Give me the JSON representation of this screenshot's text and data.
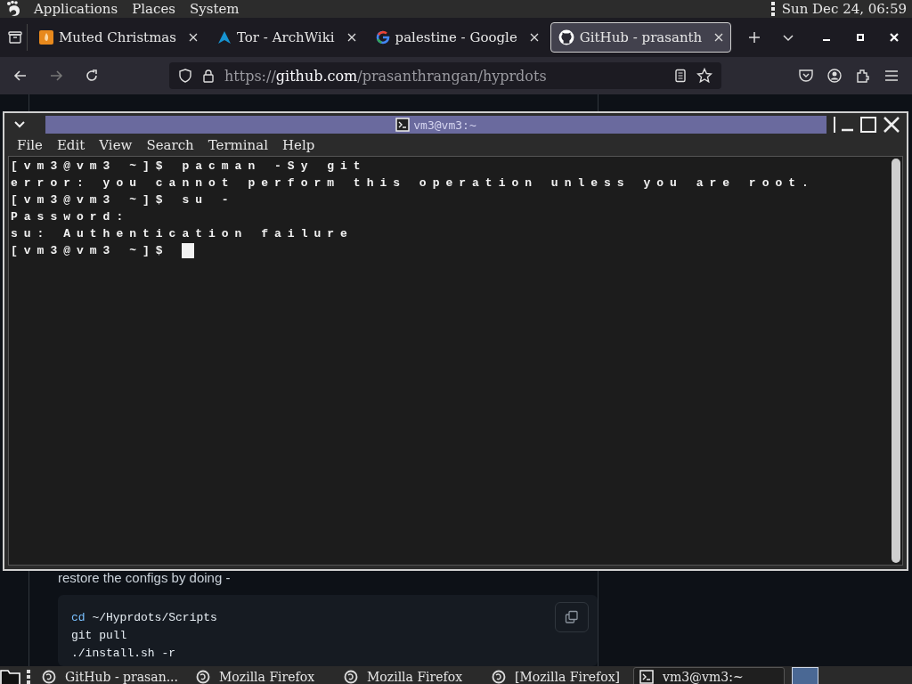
{
  "top_panel": {
    "menus": [
      "Applications",
      "Places",
      "System"
    ],
    "clock": "Sun Dec 24, 06:59"
  },
  "browser": {
    "tabs": [
      {
        "label": "Muted Christmas",
        "kind": "music",
        "selected": false
      },
      {
        "label": "Tor - ArchWiki",
        "kind": "arch",
        "selected": false
      },
      {
        "label": "palestine - Google",
        "kind": "google",
        "selected": false
      },
      {
        "label": "GitHub - prasanth",
        "kind": "github",
        "selected": true
      }
    ],
    "url": {
      "scheme": "https://",
      "host": "github.com",
      "path": "/prasanthrangan/hyprdots"
    }
  },
  "page": {
    "text": "restore the configs by doing -",
    "code": [
      {
        "keyword": "cd",
        "text": " ~/Hyprdots/Scripts"
      },
      {
        "text": "git pull"
      },
      {
        "text": "./install.sh -r"
      }
    ]
  },
  "terminal": {
    "title": "vm3@vm3:~",
    "menus": [
      "File",
      "Edit",
      "View",
      "Search",
      "Terminal",
      "Help"
    ],
    "lines": [
      "[vm3@vm3 ~]$ pacman -Sy git",
      "error: you cannot perform this operation unless you are root.",
      "[vm3@vm3 ~]$ su -",
      "Password:",
      "su: Authentication failure",
      "[vm3@vm3 ~]$ "
    ]
  },
  "taskbar": {
    "items": [
      {
        "label": "GitHub - prasan...",
        "kind": "firefox",
        "selected": false
      },
      {
        "label": "Mozilla Firefox",
        "kind": "firefox",
        "selected": false
      },
      {
        "label": "Mozilla Firefox",
        "kind": "firefox",
        "selected": false
      },
      {
        "label": "[Mozilla Firefox]",
        "kind": "firefox",
        "selected": false
      },
      {
        "label": "vm3@vm3:~",
        "kind": "terminal",
        "selected": true
      }
    ]
  }
}
